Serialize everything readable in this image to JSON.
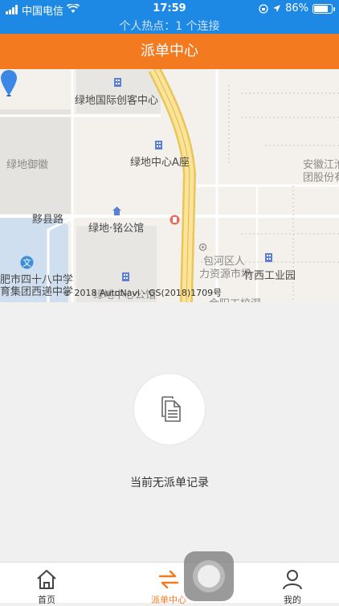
{
  "status_bar": {
    "carrier": "中国电信",
    "time": "17:59",
    "battery": "86%",
    "battery_level": 0.86,
    "hotspot": "个人热点：1 个连接"
  },
  "header": {
    "title": "派单中心"
  },
  "map": {
    "labels": {
      "creative_center": "绿地国际创客中心",
      "green_yuhui": "绿地御徽",
      "tower_a": "绿地中心A座",
      "anhui_jianghuai": "安徽江淮",
      "group_co": "团股份有",
      "yixian_road": "黟县路",
      "mingpu": "绿地·铭公馆",
      "baohe_hr": "包河区人",
      "hr_market": "力资源市场",
      "zhuxi_park": "竹西工业园",
      "school_1": "肥市四十八中学",
      "school_2": "育集团西递中学",
      "green_center_bottom": "绿地中心公馆",
      "jinyang_road": "金阳工校湿"
    },
    "copyright": "© 2018 AutoNavi - GS(2018)1709号"
  },
  "empty_state": {
    "icon": "document-icon",
    "text": "当前无派单记录"
  },
  "tabs": [
    {
      "label": "首页",
      "icon": "home-icon",
      "active": false
    },
    {
      "label": "派单中心",
      "icon": "swap-arrows-icon",
      "active": true
    },
    {
      "label": "我的",
      "icon": "person-icon",
      "active": false
    }
  ],
  "colors": {
    "status_bar": "#1E88E5",
    "header": "#F47A20",
    "active_tab": "#F47A20"
  }
}
